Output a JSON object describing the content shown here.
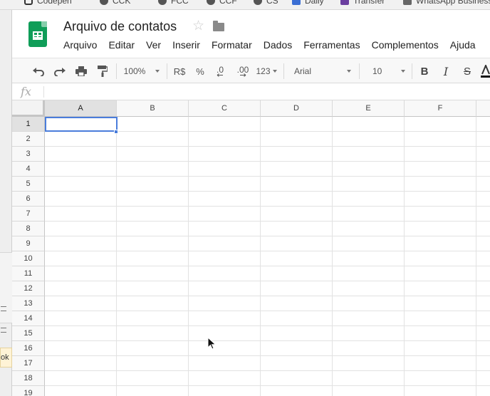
{
  "bookmarks": [
    {
      "label": "Codepen",
      "icon": "codepen-icon"
    },
    {
      "label": "CCK",
      "icon": "bookmark-icon"
    },
    {
      "label": "FCC",
      "icon": "bookmark-icon"
    },
    {
      "label": "CCF",
      "icon": "bookmark-icon"
    },
    {
      "label": "CS",
      "icon": "bookmark-icon"
    },
    {
      "label": "Daily",
      "icon": "bookmark-icon"
    },
    {
      "label": "Transfer",
      "icon": "bookmark-icon"
    },
    {
      "label": "WhatsApp Business",
      "icon": "whatsapp-icon"
    }
  ],
  "background_window": {
    "peek_text": "ok ir"
  },
  "document": {
    "title": "Arquivo de contatos"
  },
  "menu": [
    "Arquivo",
    "Editar",
    "Ver",
    "Inserir",
    "Formatar",
    "Dados",
    "Ferramentas",
    "Complementos",
    "Ajuda"
  ],
  "toolbar": {
    "zoom": "100%",
    "currency": "R$",
    "percent": "%",
    "decimal_decrease": ".0",
    "decimal_increase": ".00",
    "number_format": "123",
    "font": "Arial",
    "font_size": "10",
    "bold": "B",
    "italic": "I",
    "strike": "S"
  },
  "formula_bar": {
    "label": "fx",
    "value": ""
  },
  "grid": {
    "columns": [
      "A",
      "B",
      "C",
      "D",
      "E",
      "F"
    ],
    "rows": [
      "1",
      "2",
      "3",
      "4",
      "5",
      "6",
      "7",
      "8",
      "9",
      "10",
      "11",
      "12",
      "13",
      "14",
      "15",
      "16",
      "17",
      "18",
      "19"
    ],
    "active_cell": "A1"
  },
  "colors": {
    "sheets_green": "#0f9d58",
    "selection_blue": "#4a7ddb"
  }
}
